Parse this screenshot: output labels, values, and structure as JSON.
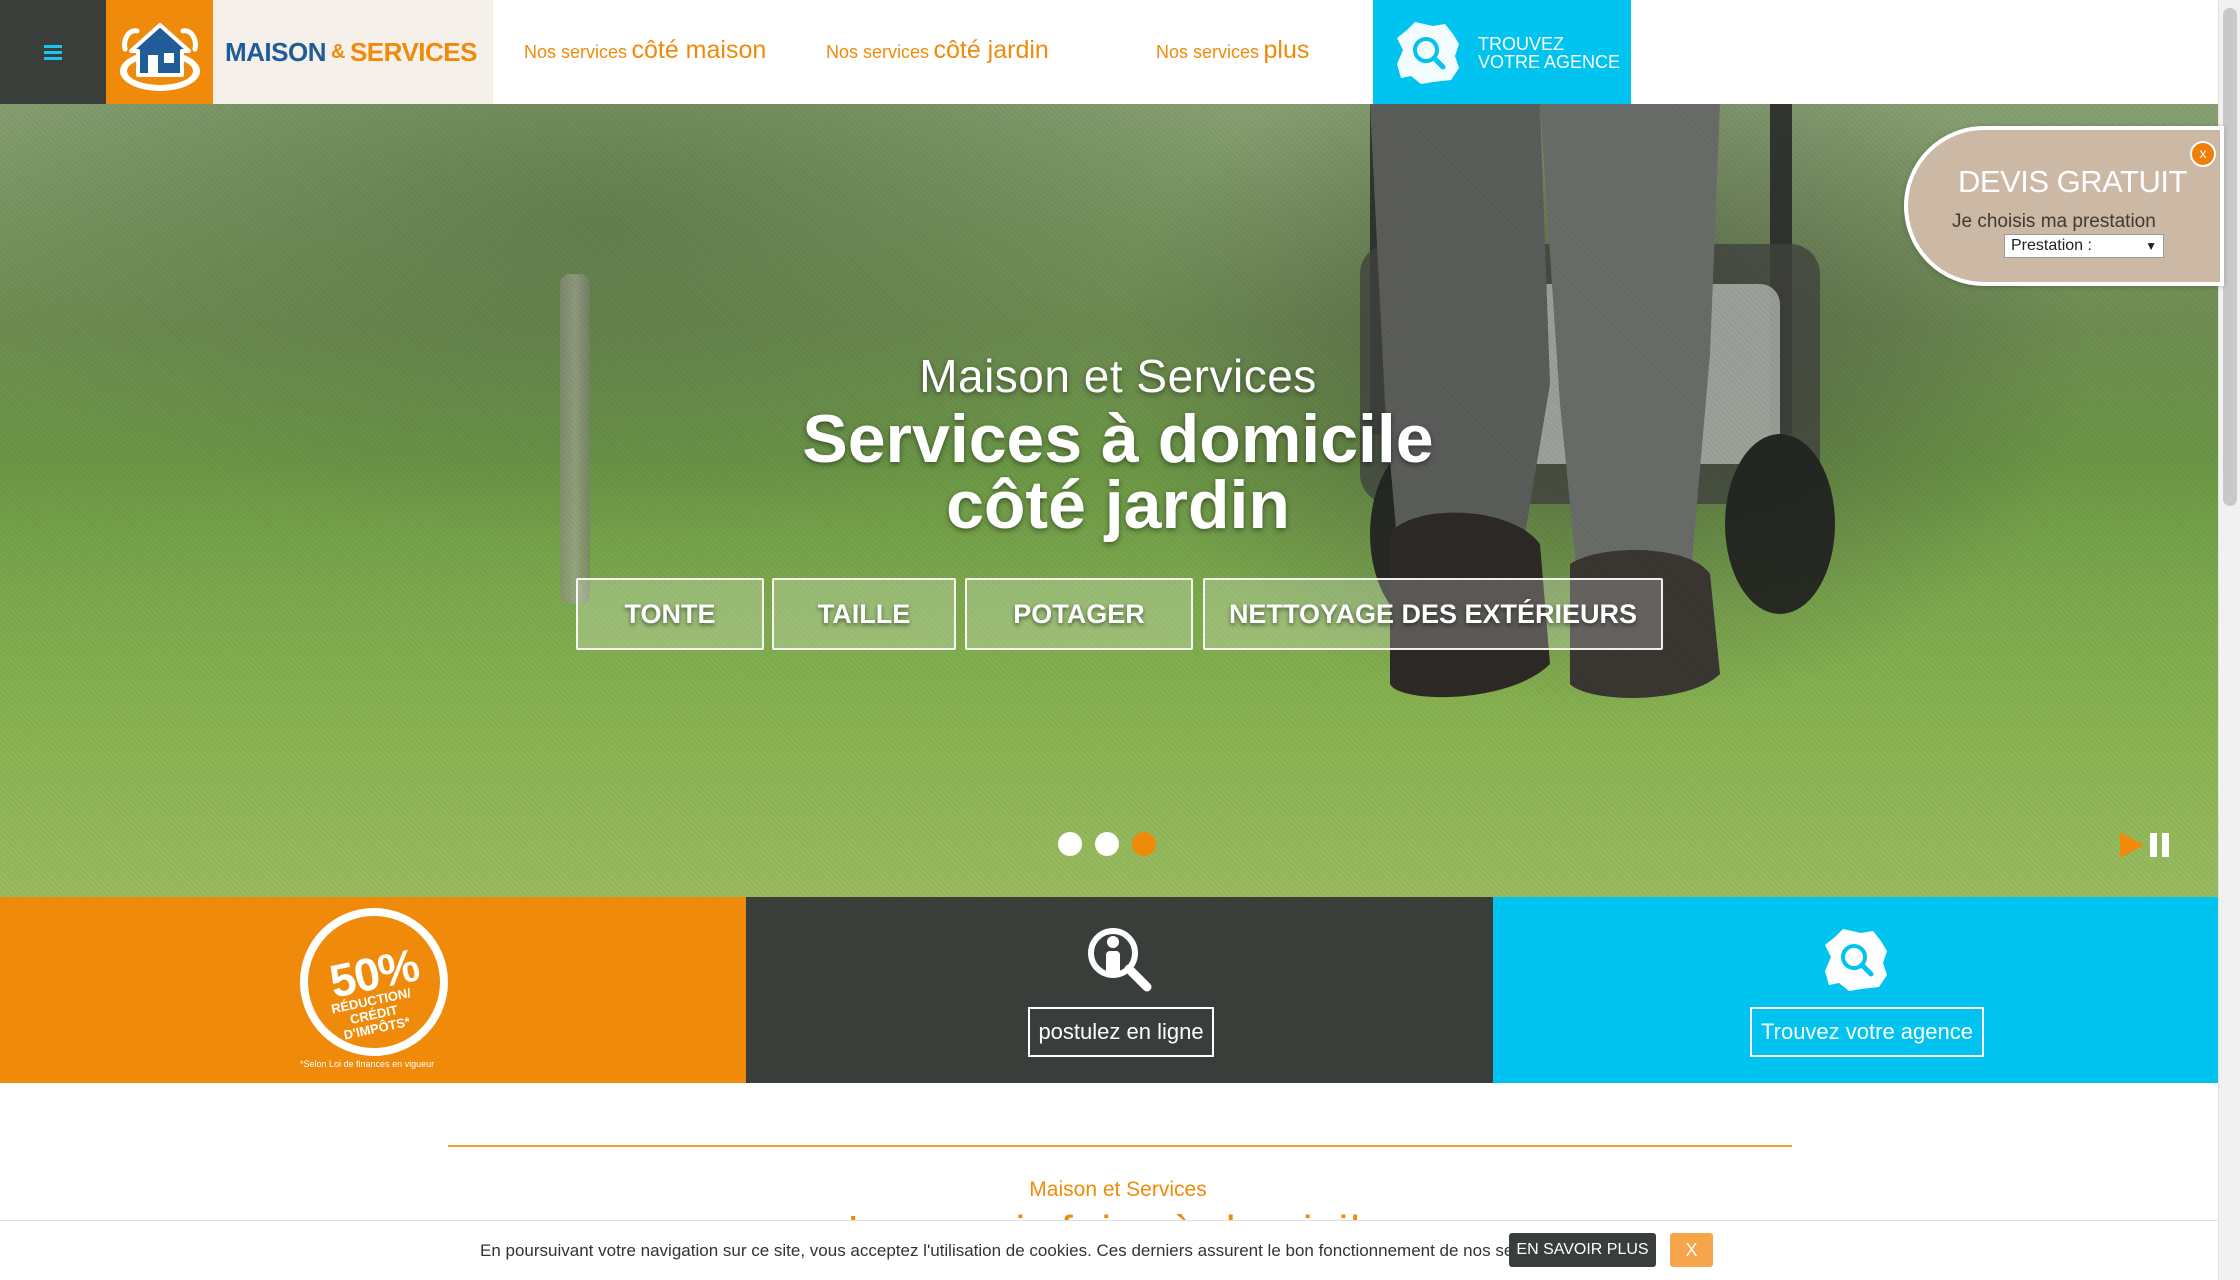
{
  "header": {
    "menu_icon": "hamburger-icon",
    "logo": {
      "icon": "house-logo-icon",
      "brand_part1": "MAISON",
      "brand_amp": "&",
      "brand_part2": "SERVICES"
    },
    "nav": [
      {
        "small": "Nos services",
        "big": "côté maison"
      },
      {
        "small": "Nos services",
        "big": "côté jardin"
      },
      {
        "small": "Nos services",
        "big": "plus"
      }
    ],
    "agency_cta": {
      "line1": "TROUVEZ",
      "line2": "VOTRE AGENCE",
      "icon": "france-map-search-icon"
    }
  },
  "hero": {
    "subtitle": "Maison et Services",
    "title_line1": "Services à domicile",
    "title_line2": "côté jardin",
    "buttons": [
      "TONTE",
      "TAILLE",
      "POTAGER",
      "NETTOYAGE DES EXTÉRIEURS"
    ],
    "slides_count": 3,
    "active_slide": 3
  },
  "devis": {
    "title": "DEVIS GRATUIT",
    "subtitle": "Je choisis ma prestation",
    "select_value": "Prestation :",
    "close_label": "x"
  },
  "panels": {
    "tax": {
      "percent": "50%",
      "label": "RÉDUCTION/ CRÉDIT D'IMPÔTS*",
      "footnote": "*Selon Loi de finances en vigueur"
    },
    "jobs": {
      "icon": "job-search-person-icon",
      "button": "postulez en ligne"
    },
    "agency": {
      "icon": "france-map-search-icon",
      "button": "Trouvez votre agence"
    }
  },
  "section": {
    "subtitle": "Maison et Services",
    "title_peek": "Le savoir-faire à domicile"
  },
  "cookie": {
    "message": "En poursuivant votre navigation sur ce site, vous acceptez l'utilisation de cookies. Ces derniers assurent le bon fonctionnement de nos services.",
    "more_label": "EN SAVOIR PLUS",
    "close_label": "X"
  },
  "colors": {
    "orange": "#f08a0a",
    "cyan": "#00c4ef",
    "dark": "#3a3e3a",
    "navy": "#1f5c98",
    "devis_bg": "#cbb8a5"
  }
}
